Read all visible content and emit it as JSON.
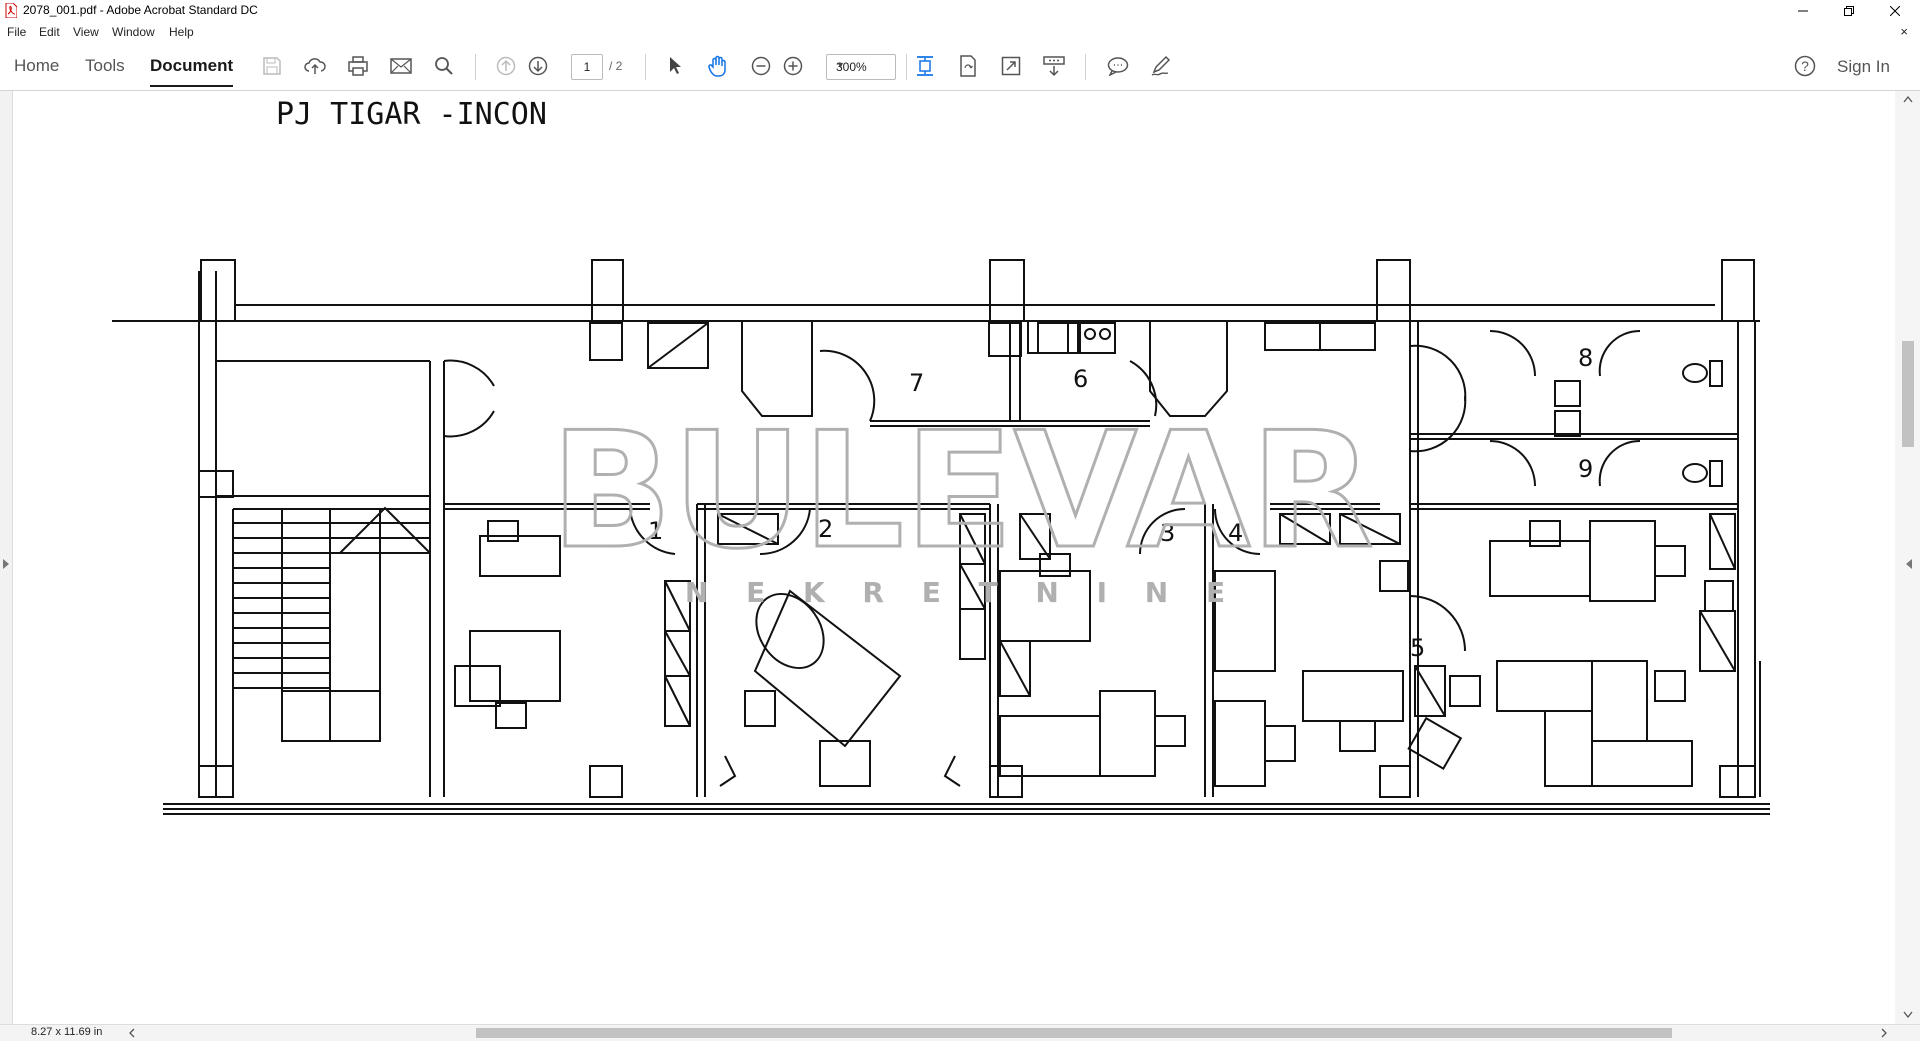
{
  "window": {
    "title": "2078_001.pdf - Adobe Acrobat Standard DC",
    "icons": [
      "pdf-icon",
      "minimize-icon",
      "restore-icon",
      "close-icon"
    ]
  },
  "menu": {
    "file": "File",
    "edit": "Edit",
    "view": "View",
    "window": "Window",
    "help": "Help",
    "close_doc": "×"
  },
  "toolbar": {
    "tabs": {
      "home": "Home",
      "tools": "Tools",
      "document": "Document"
    },
    "page_current": "1",
    "page_total": "/ 2",
    "zoom": "300%",
    "sign_in": "Sign In",
    "help_glyph": "?"
  },
  "document": {
    "heading": "PJ TIGAR -INCON",
    "watermark_main": "BULEVAR",
    "watermark_sub": "N E K R E T N I N E",
    "room_numbers": [
      "1",
      "2",
      "3",
      "4",
      "5",
      "6",
      "7",
      "8",
      "9"
    ]
  },
  "status": {
    "page_size": "8.27 x 11.69 in"
  },
  "colors": {
    "accent": "#1473e6",
    "drawing": "#111111",
    "watermark": "#b0b0b0"
  }
}
